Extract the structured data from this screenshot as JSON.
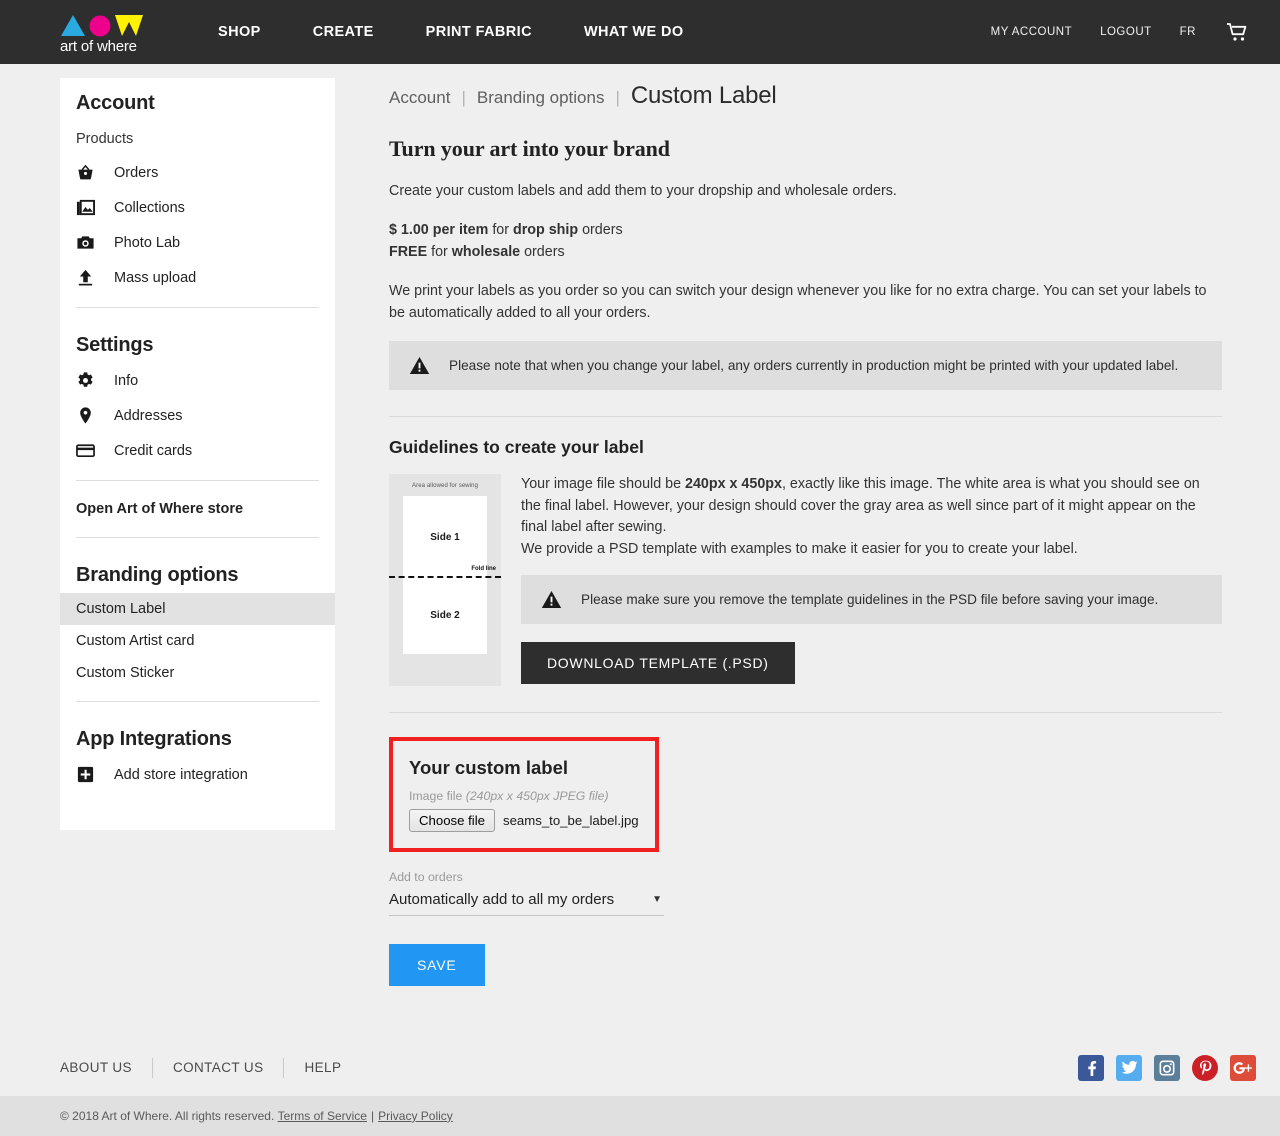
{
  "header": {
    "logo_text": "art of where",
    "logo_colors": {
      "triangle": "#29ABE2",
      "circle": "#EC008C",
      "w": "#FFF200"
    },
    "nav": [
      {
        "label": "SHOP"
      },
      {
        "label": "CREATE"
      },
      {
        "label": "PRINT FABRIC"
      },
      {
        "label": "WHAT WE DO"
      }
    ],
    "nav_right": [
      {
        "label": "MY ACCOUNT"
      },
      {
        "label": "LOGOUT"
      },
      {
        "label": "FR"
      }
    ],
    "cart_icon": "shopping-cart-icon",
    "background": "#2e2e2e"
  },
  "sidebar": {
    "title": "Account",
    "products_label": "Products",
    "products_items": [
      {
        "label": "Orders",
        "icon": "basket-icon"
      },
      {
        "label": "Collections",
        "icon": "images-icon"
      },
      {
        "label": "Photo Lab",
        "icon": "camera-icon"
      },
      {
        "label": "Mass upload",
        "icon": "upload-icon"
      }
    ],
    "settings_label": "Settings",
    "settings_items": [
      {
        "label": "Info",
        "icon": "gear-icon"
      },
      {
        "label": "Addresses",
        "icon": "map-pin-icon"
      },
      {
        "label": "Credit cards",
        "icon": "credit-card-icon"
      }
    ],
    "store_link": "Open Art of Where store",
    "branding_label": "Branding options",
    "branding_items": [
      {
        "label": "Custom Label",
        "active": true
      },
      {
        "label": "Custom Artist card",
        "active": false
      },
      {
        "label": "Custom Sticker",
        "active": false
      }
    ],
    "integrations_label": "App Integrations",
    "integrations_items": [
      {
        "label": "Add store integration",
        "icon": "plus-square-icon"
      }
    ]
  },
  "breadcrumb": {
    "item1": "Account",
    "div1": "|",
    "item2": "Branding options",
    "div2": "|",
    "current": "Custom Label"
  },
  "intro": {
    "heading": "Turn your art into your brand",
    "paragraph": "Create your custom labels and add them to your dropship and wholesale orders.",
    "price_bold_1": "$ 1.00 per item",
    "price_mid_1": " for ",
    "price_bold_2": "drop ship",
    "price_tail_1": " orders",
    "price_bold_3": "FREE",
    "price_mid_2": " for ",
    "price_bold_4": "wholesale",
    "price_tail_2": " orders",
    "paragraph2": "We print your labels as you order so you can switch your design whenever you like for no extra charge. You can set your labels to be automatically added to all your orders.",
    "notice": "Please note that when you change your label, any orders currently in production might be printed with your updated label.",
    "notice_icon": "warning-triangle-icon"
  },
  "guidelines": {
    "heading": "Guidelines to create your label",
    "preview": {
      "sewing_caption": "Area allowed for sewing",
      "side1": "Side 1",
      "fold_line": "Fold line",
      "side2": "Side 2"
    },
    "text_pre": "Your image file should be ",
    "text_dims": "240px x 450px",
    "text_post": ", exactly like this image. The white area is what you should see on the final label. However, your design should cover the gray area as well since part of it might appear on the final label after sewing.",
    "text_line2": "We provide a PSD template with examples to make it easier for you to create your label.",
    "notice": "Please make sure you remove the template guidelines in the PSD file before saving your image.",
    "notice_icon": "warning-triangle-icon",
    "download_button": "DOWNLOAD TEMPLATE (.PSD)"
  },
  "custom_label": {
    "heading": "Your custom label",
    "file_label_plain": "Image file ",
    "file_label_italic": "(240px x 450px JPEG file)",
    "choose_button": "Choose file",
    "file_name": "seams_to_be_label.jpg",
    "highlight_color": "#f02020",
    "add_to_orders_label": "Add to orders",
    "add_to_orders_value": "Automatically add to all my orders",
    "add_to_orders_caret": "▼",
    "save_button": "SAVE",
    "save_button_color": "#2196f3"
  },
  "footer": {
    "links": [
      {
        "label": "ABOUT US"
      },
      {
        "label": "CONTACT US"
      },
      {
        "label": "HELP"
      }
    ],
    "social": [
      {
        "name": "facebook-icon",
        "glyph": "f",
        "color": "#3b5998"
      },
      {
        "name": "twitter-icon",
        "glyph": "t",
        "color": "#55acee"
      },
      {
        "name": "instagram-icon",
        "glyph": "i",
        "color": "#5b7f99"
      },
      {
        "name": "pinterest-icon",
        "glyph": "P",
        "color": "#cb2027"
      },
      {
        "name": "googleplus-icon",
        "glyph": "g+",
        "color": "#dd4b39"
      }
    ],
    "copyright": "© 2018 Art of Where. All rights reserved.",
    "terms": "Terms of Service",
    "sep": "|",
    "privacy": "Privacy Policy"
  }
}
